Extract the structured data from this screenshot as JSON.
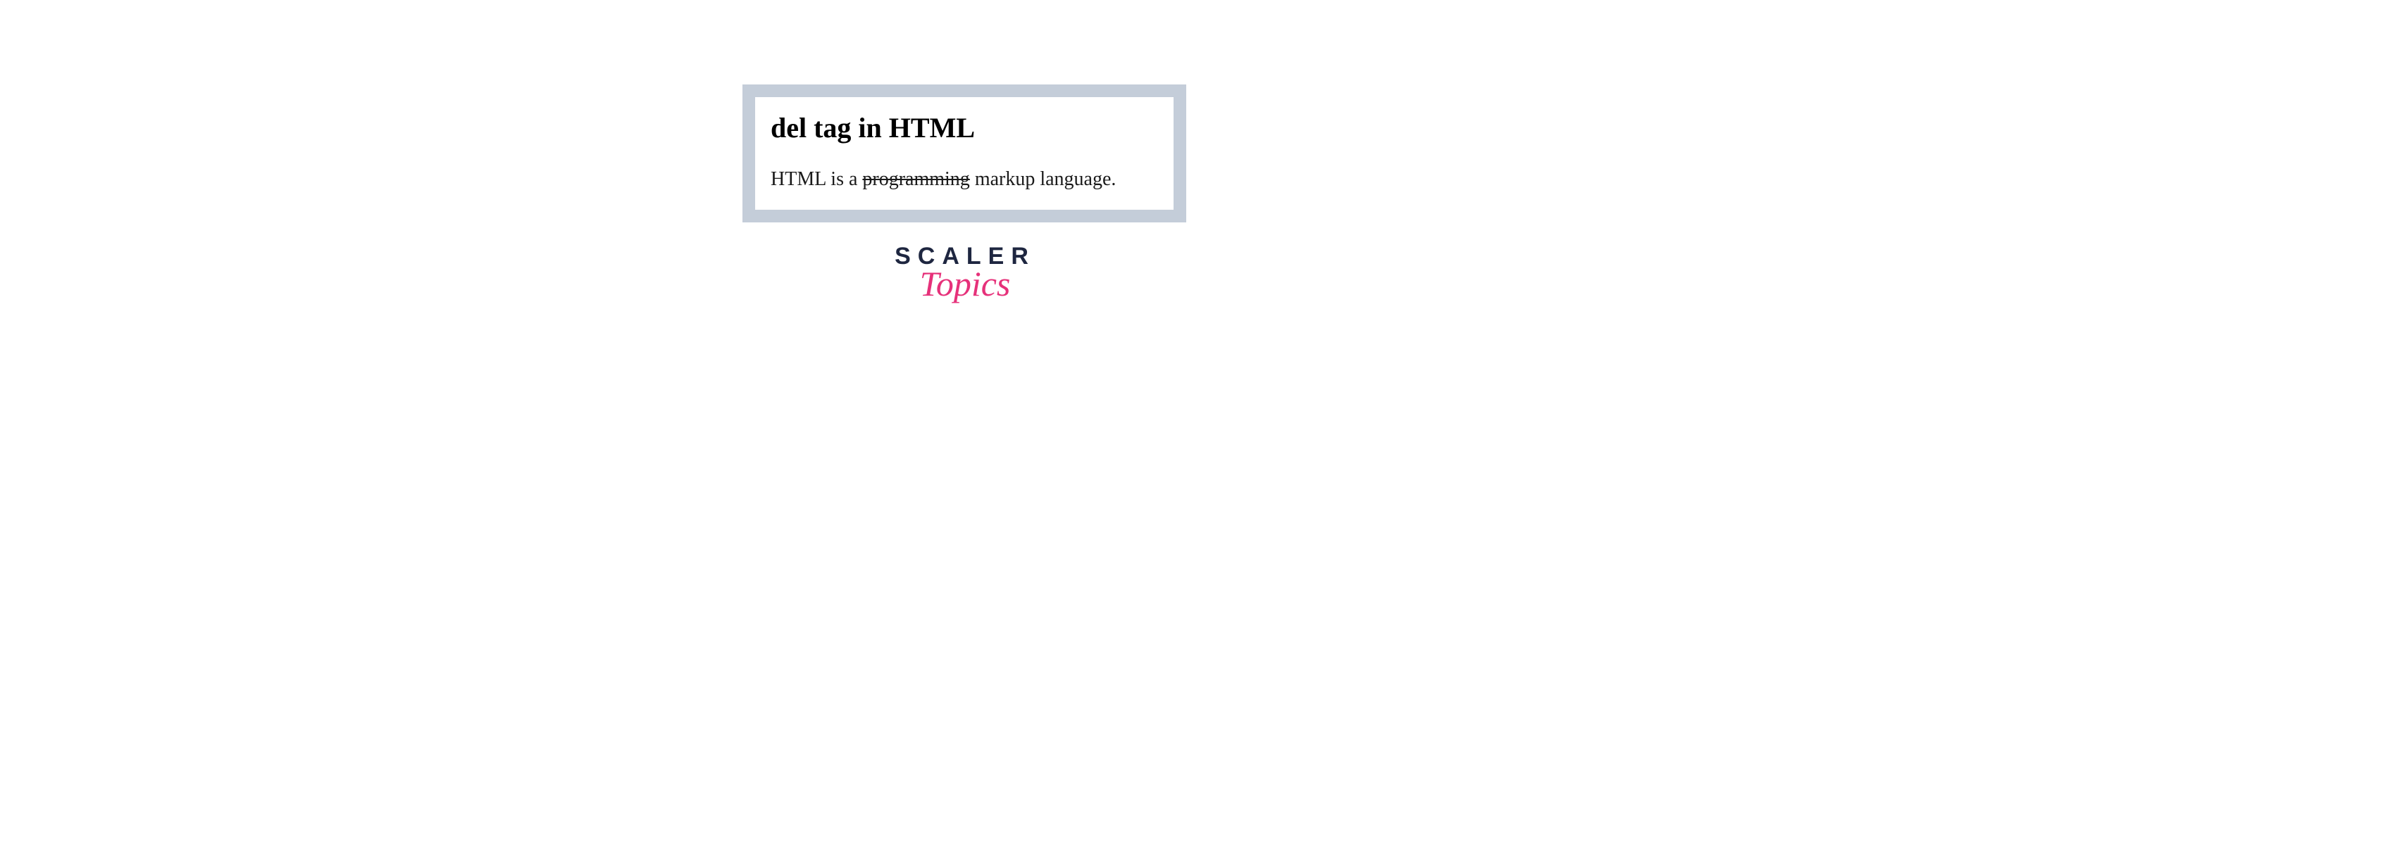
{
  "card": {
    "heading": "del tag in HTML",
    "sentence": {
      "prefix": "HTML is a ",
      "deleted": "programming",
      "suffix": " markup language."
    }
  },
  "logo": {
    "line1": "SCALER",
    "line2": "Topics"
  }
}
